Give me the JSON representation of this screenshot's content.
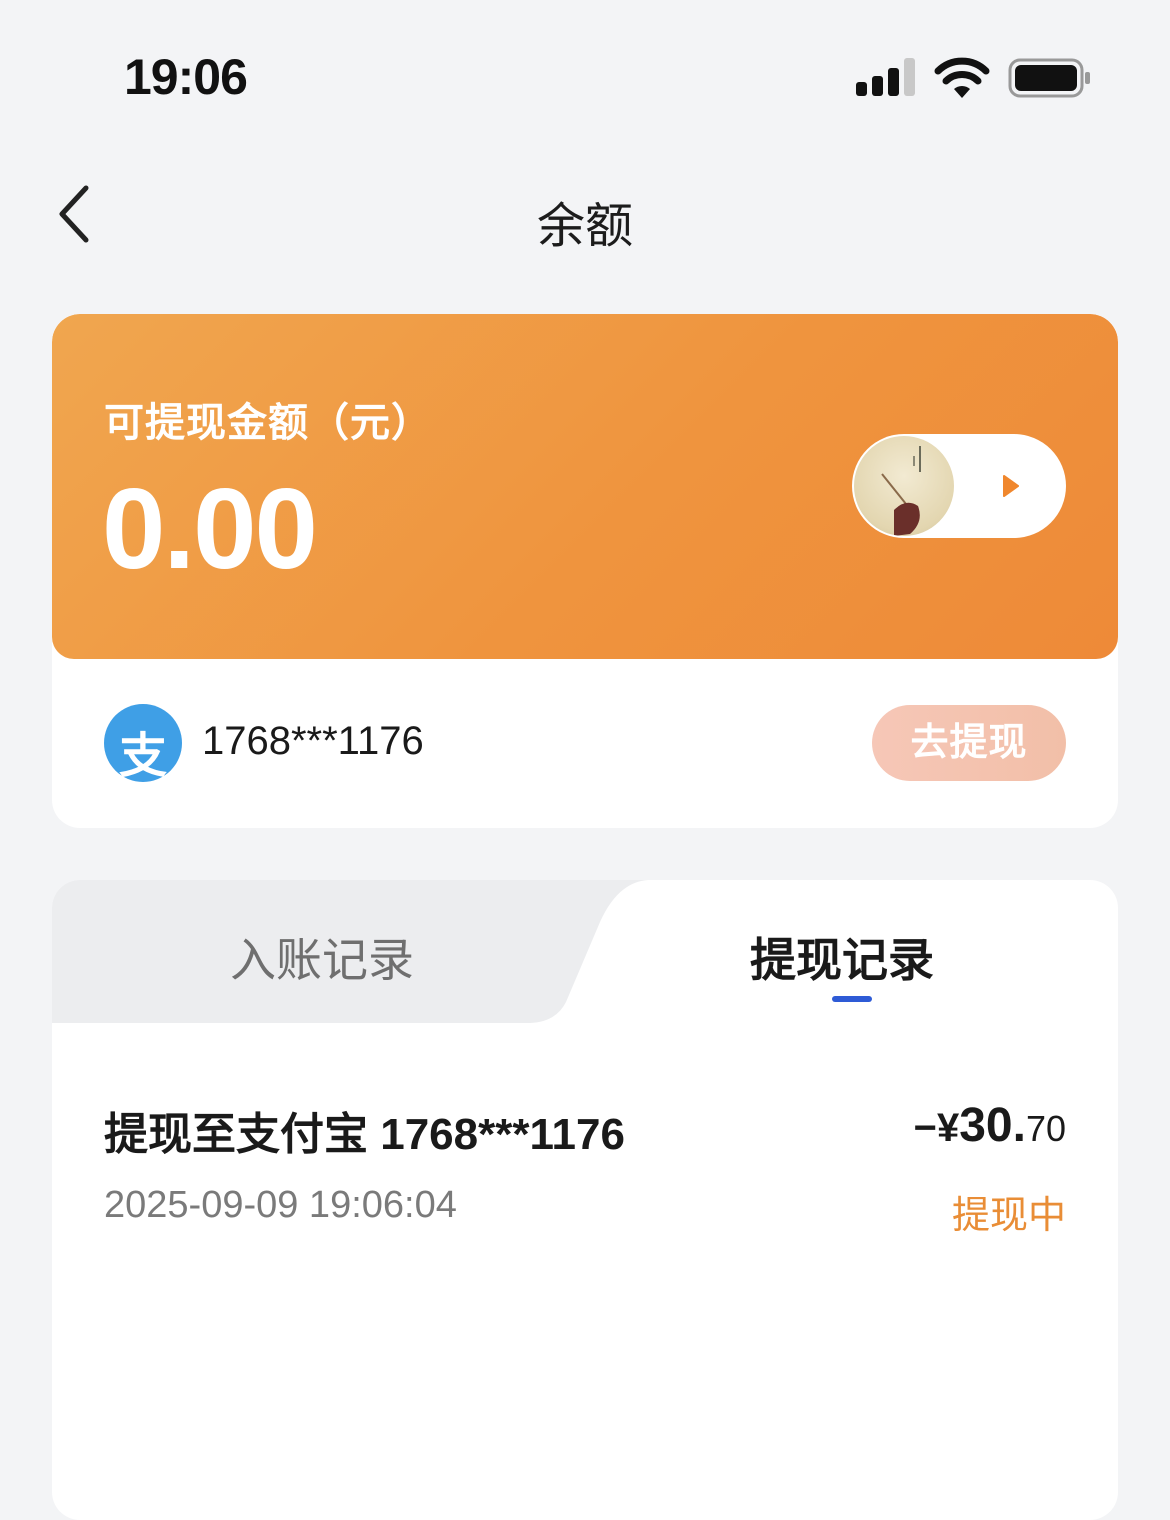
{
  "status_bar": {
    "time": "19:06"
  },
  "nav": {
    "title": "余额"
  },
  "balance_card": {
    "label": "可提现金额（元）",
    "amount": "0.00",
    "account_icon": "支",
    "account": "1768***1176",
    "withdraw_button": "去提现"
  },
  "tabs": [
    {
      "label": "入账记录",
      "active": false
    },
    {
      "label": "提现记录",
      "active": true
    }
  ],
  "records": [
    {
      "title": "提现至支付宝 1768***1176",
      "time": "2025-09-09 19:06:04",
      "amount_sign": "−¥",
      "amount_int": "30.",
      "amount_dec": "70",
      "status": "提现中"
    }
  ],
  "colors": {
    "card_orange": "#ef943e",
    "status_orange": "#e98d36",
    "alipay_blue": "#3f9fe6",
    "tab_underline": "#2e5bd6",
    "withdraw_button": "#f4c3ae"
  },
  "icons": [
    "back-chevron-icon",
    "signal-icon",
    "wifi-icon",
    "battery-icon",
    "alipay-icon",
    "play-icon"
  ]
}
